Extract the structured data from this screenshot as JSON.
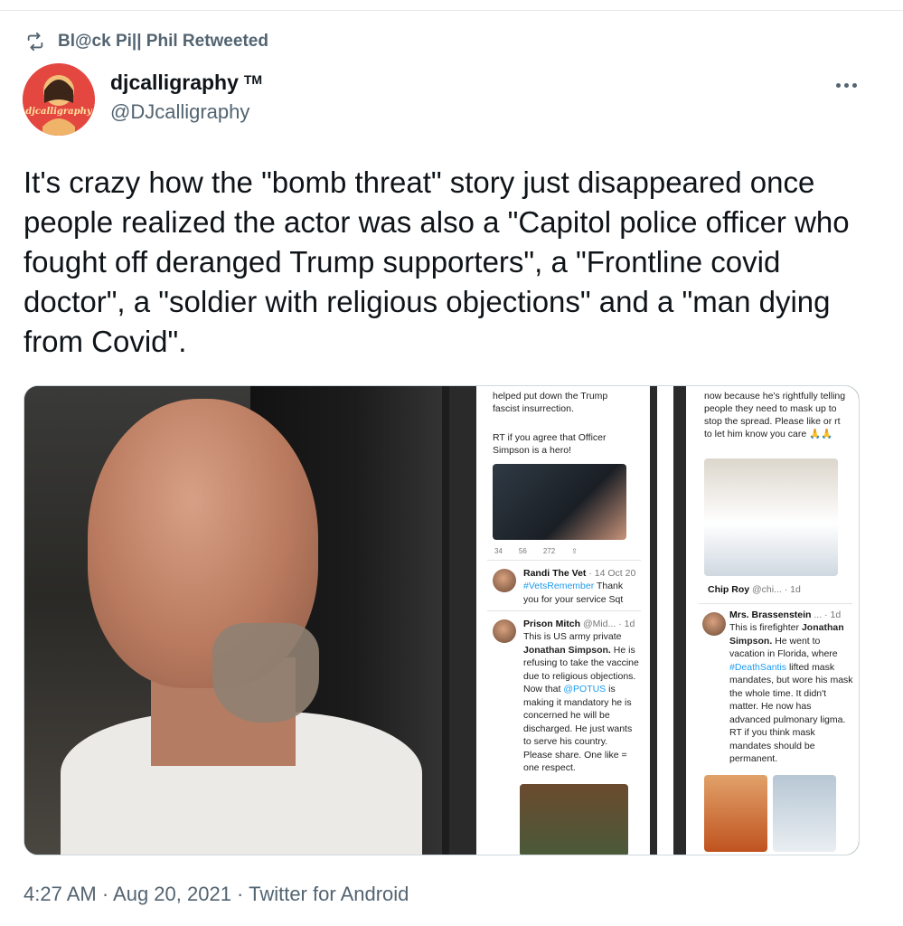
{
  "retweet": {
    "label": "Bl@ck Pi|| Phil Retweeted"
  },
  "author": {
    "avatar_text": "djcalligraphy",
    "name": "djcalligraphy",
    "name_mark": "TM",
    "handle": "@DJcalligraphy"
  },
  "tweet": {
    "text": "It's crazy how the \"bomb threat\" story just disappeared once people realized the actor was also a \"Capitol police officer who fought off deranged Trump supporters\", a \"Frontline covid doctor\", a \"soldier with religious objections\" and a \"man dying from Covid\"."
  },
  "media": {
    "col_a": {
      "top_text": "helped put down the Trump fascist insurrection.",
      "rt_text": "RT if you agree that Officer Simpson is a hero!",
      "counts": [
        "34",
        "56",
        "272"
      ],
      "reply1": {
        "name": "Randi The Vet",
        "meta": "· 14 Oct 20",
        "tag": "#VetsRemember",
        "body": "Thank you for your service Sqt"
      },
      "reply2": {
        "name": "Prison Mitch",
        "meta": "@Mid... · 1d",
        "line1": "This is US army private",
        "name_bold": "Jonathan Simpson.",
        "line2": "He is refusing to take the vaccine due to religious objections. Now that",
        "mention": "@POTUS",
        "line3": "is making it mandatory he is concerned he will be discharged. He just wants to serve his country. Please share. One like = one respect."
      }
    },
    "col_b": {
      "top_text": "now because he's rightfully telling people they need to mask up to stop the spread. Please like or rt to let him know you care 🙏🙏",
      "reply1": {
        "name": "Chip Roy",
        "meta": "@chi... · 1d"
      },
      "reply2": {
        "name": "Mrs. Brassenstein",
        "meta": "... · 1d",
        "line1": "This is firefighter",
        "name_bold": "Jonathan Simpson.",
        "line2": "He went to vacation in Florida, where",
        "tag": "#DeathSantis",
        "line3": "lifted mask mandates, but wore his mask the whole time. It didn't matter. He now has advanced pulmonary ligma. RT if you think mask mandates should be permanent."
      }
    }
  },
  "footer": {
    "text": "4:27 AM · Aug 20, 2021 · Twitter for Android"
  },
  "colors": {
    "accent": "#1d9bf0",
    "muted": "#536471",
    "text": "#0f1419"
  }
}
